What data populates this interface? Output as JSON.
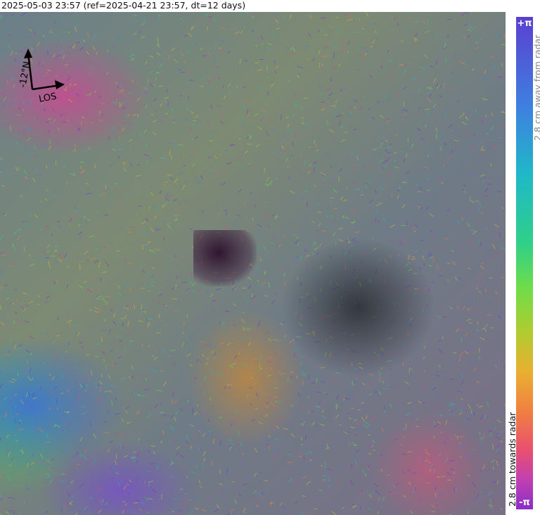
{
  "title": "2025-05-03 23:57 (ref=2025-04-21 23:57, dt=12 days)",
  "north_arrow": {
    "north_label": "-12°N",
    "los_label": "LOS",
    "icon": "north-arrow-icon"
  },
  "colorbar": {
    "top_label": "+π",
    "bottom_label": "-π",
    "away_label": "2.8 cm away from radar",
    "towards_label": "2.8 cm towards radar",
    "colors": [
      "#5a3fd0",
      "#3f7fe0",
      "#1fb8c8",
      "#2fd088",
      "#6fdc4a",
      "#b0cc30",
      "#e8b030",
      "#f08040",
      "#e85070",
      "#c040b0",
      "#8a2fc8"
    ]
  }
}
